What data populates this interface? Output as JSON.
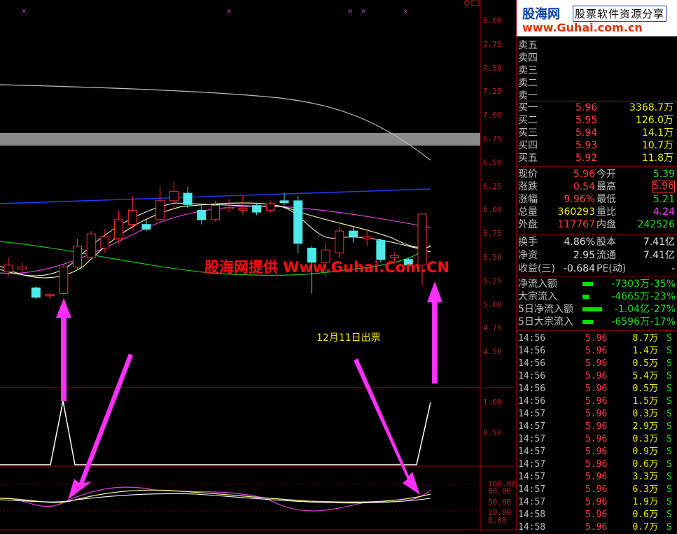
{
  "watermark": "股海网提供 Www.Guhai.Com.CN",
  "annotation_date": "12月11日出票",
  "logo": {
    "brand": "股海网",
    "tagline": "股票软件资源分享",
    "url": "www.Guhai.com.cn"
  },
  "price_axis": [
    "8.00",
    "7.75",
    "7.50",
    "7.25",
    "7.00",
    "6.75",
    "6.50",
    "6.25",
    "6.00",
    "5.75",
    "5.50",
    "5.25",
    "5.00",
    "4.75",
    "4.50"
  ],
  "signal_axis": [
    "1.00",
    "0.50"
  ],
  "osc_axis": [
    "100.00",
    "80.00",
    "50.00",
    "20.00",
    "0.00"
  ],
  "order_book": {
    "sell": [
      {
        "label": "卖五",
        "price": "",
        "vol": ""
      },
      {
        "label": "卖四",
        "price": "",
        "vol": ""
      },
      {
        "label": "卖三",
        "price": "",
        "vol": ""
      },
      {
        "label": "卖二",
        "price": "",
        "vol": ""
      },
      {
        "label": "卖一",
        "price": "",
        "vol": ""
      }
    ],
    "buy": [
      {
        "label": "买一",
        "price": "5.96",
        "vol": "3368.7万"
      },
      {
        "label": "买二",
        "price": "5.95",
        "vol": "126.0万"
      },
      {
        "label": "买三",
        "price": "5.94",
        "vol": "14.1万"
      },
      {
        "label": "买四",
        "price": "5.93",
        "vol": "10.7万"
      },
      {
        "label": "买五",
        "price": "5.92",
        "vol": "11.8万"
      }
    ]
  },
  "quote": [
    {
      "l1": "现价",
      "v1": "5.96",
      "c1": "red",
      "l2": "今开",
      "v2": "5.39",
      "c2": "green"
    },
    {
      "l1": "涨跌",
      "v1": "0.54",
      "c1": "red",
      "l2": "最高",
      "v2": "5.96",
      "c2": "red"
    },
    {
      "l1": "涨幅",
      "v1": "9.96%",
      "c1": "red",
      "l2": "最低",
      "v2": "5.21",
      "c2": "green"
    },
    {
      "l1": "总量",
      "v1": "360293",
      "c1": "yellow",
      "l2": "量比",
      "v2": "4.24",
      "c2": "magenta"
    },
    {
      "l1": "外盘",
      "v1": "117767",
      "c1": "red",
      "l2": "内盘",
      "v2": "242526",
      "c2": "green"
    }
  ],
  "fundamentals": [
    {
      "l1": "换手",
      "v1": "4.86%",
      "l2": "股本",
      "v2": "7.41亿"
    },
    {
      "l1": "净资",
      "v1": "2.95",
      "l2": "流通",
      "v2": "7.41亿"
    },
    {
      "l1": "收益(三)",
      "v1": "-0.684",
      "l2": "PE(动)",
      "v2": "-"
    }
  ],
  "flows": [
    {
      "label": "净流入额",
      "bar": 0.55,
      "value": "-7303万",
      "pct": "-35%"
    },
    {
      "label": "大宗流入",
      "bar": 0.35,
      "value": "-4665万",
      "pct": "-23%"
    },
    {
      "label": "5日净流入额",
      "bar": 1.0,
      "value": "-1.04亿",
      "pct": "-27%"
    },
    {
      "label": "5日大宗流入",
      "bar": 0.55,
      "value": "-6596万",
      "pct": "-17%"
    }
  ],
  "ticks": [
    {
      "time": "14:56",
      "price": "5.96",
      "vol": "8.7万",
      "dir": "S"
    },
    {
      "time": "14:56",
      "price": "5.96",
      "vol": "1.4万",
      "dir": "S"
    },
    {
      "time": "14:56",
      "price": "5.96",
      "vol": "0.5万",
      "dir": "S"
    },
    {
      "time": "14:56",
      "price": "5.96",
      "vol": "5.4万",
      "dir": "S"
    },
    {
      "time": "14:56",
      "price": "5.96",
      "vol": "0.5万",
      "dir": "S"
    },
    {
      "time": "14:56",
      "price": "5.96",
      "vol": "1.5万",
      "dir": "S"
    },
    {
      "time": "14:57",
      "price": "5.96",
      "vol": "0.3万",
      "dir": "S"
    },
    {
      "time": "14:57",
      "price": "5.96",
      "vol": "2.9万",
      "dir": "S"
    },
    {
      "time": "14:57",
      "price": "5.96",
      "vol": "0.3万",
      "dir": "S"
    },
    {
      "time": "14:57",
      "price": "5.96",
      "vol": "0.9万",
      "dir": "S"
    },
    {
      "time": "14:57",
      "price": "5.96",
      "vol": "0.6万",
      "dir": "S"
    },
    {
      "time": "14:57",
      "price": "5.96",
      "vol": "3.3万",
      "dir": "S"
    },
    {
      "time": "14:57",
      "price": "5.96",
      "vol": "6.3万",
      "dir": "S"
    },
    {
      "time": "14:57",
      "price": "5.96",
      "vol": "1.9万",
      "dir": "S"
    },
    {
      "time": "14:58",
      "price": "5.96",
      "vol": "0.6万",
      "dir": "S"
    },
    {
      "time": "14:58",
      "price": "5.96",
      "vol": "0.7万",
      "dir": "S"
    }
  ],
  "chart_data": {
    "type": "candlestick",
    "ylim": [
      4.4,
      8.05
    ],
    "candles": [
      {
        "o": 5.35,
        "c": 5.42,
        "h": 5.5,
        "l": 5.3
      },
      {
        "o": 5.38,
        "c": 5.4,
        "h": 5.45,
        "l": 5.33
      },
      {
        "o": 5.18,
        "c": 5.08,
        "h": 5.2,
        "l": 5.06
      },
      {
        "o": 5.1,
        "c": 5.11,
        "h": 5.13,
        "l": 5.06
      },
      {
        "o": 5.12,
        "c": 5.4,
        "h": 5.42,
        "l": 5.1
      },
      {
        "o": 5.4,
        "c": 5.62,
        "h": 5.7,
        "l": 5.38
      },
      {
        "o": 5.5,
        "c": 5.75,
        "h": 5.78,
        "l": 5.48
      },
      {
        "o": 5.6,
        "c": 5.72,
        "h": 5.8,
        "l": 5.55
      },
      {
        "o": 5.7,
        "c": 5.9,
        "h": 6.0,
        "l": 5.65
      },
      {
        "o": 5.85,
        "c": 6.0,
        "h": 6.15,
        "l": 5.8
      },
      {
        "o": 5.85,
        "c": 5.8,
        "h": 5.9,
        "l": 5.78
      },
      {
        "o": 5.9,
        "c": 6.1,
        "h": 6.25,
        "l": 5.88
      },
      {
        "o": 6.1,
        "c": 6.2,
        "h": 6.3,
        "l": 6.0
      },
      {
        "o": 6.18,
        "c": 6.06,
        "h": 6.25,
        "l": 6.02
      },
      {
        "o": 6.0,
        "c": 5.9,
        "h": 6.05,
        "l": 5.85
      },
      {
        "o": 5.9,
        "c": 6.05,
        "h": 6.1,
        "l": 5.88
      },
      {
        "o": 6.02,
        "c": 6.03,
        "h": 6.12,
        "l": 5.98
      },
      {
        "o": 6.0,
        "c": 6.02,
        "h": 6.15,
        "l": 5.95
      },
      {
        "o": 6.05,
        "c": 5.98,
        "h": 6.08,
        "l": 5.95
      },
      {
        "o": 6.0,
        "c": 6.07,
        "h": 6.1,
        "l": 5.98
      },
      {
        "o": 6.1,
        "c": 6.08,
        "h": 6.18,
        "l": 6.05
      },
      {
        "o": 6.1,
        "c": 5.65,
        "h": 6.15,
        "l": 5.55
      },
      {
        "o": 5.6,
        "c": 5.45,
        "h": 5.62,
        "l": 5.12
      },
      {
        "o": 5.45,
        "c": 5.58,
        "h": 5.65,
        "l": 5.3
      },
      {
        "o": 5.55,
        "c": 5.78,
        "h": 5.82,
        "l": 5.5
      },
      {
        "o": 5.78,
        "c": 5.72,
        "h": 5.82,
        "l": 5.66
      },
      {
        "o": 5.7,
        "c": 5.72,
        "h": 5.8,
        "l": 5.62
      },
      {
        "o": 5.68,
        "c": 5.48,
        "h": 5.7,
        "l": 5.45
      },
      {
        "o": 5.5,
        "c": 5.52,
        "h": 5.55,
        "l": 5.45
      },
      {
        "o": 5.48,
        "c": 5.42,
        "h": 5.5,
        "l": 5.4
      },
      {
        "o": 5.42,
        "c": 5.96,
        "h": 5.96,
        "l": 5.21
      }
    ]
  }
}
